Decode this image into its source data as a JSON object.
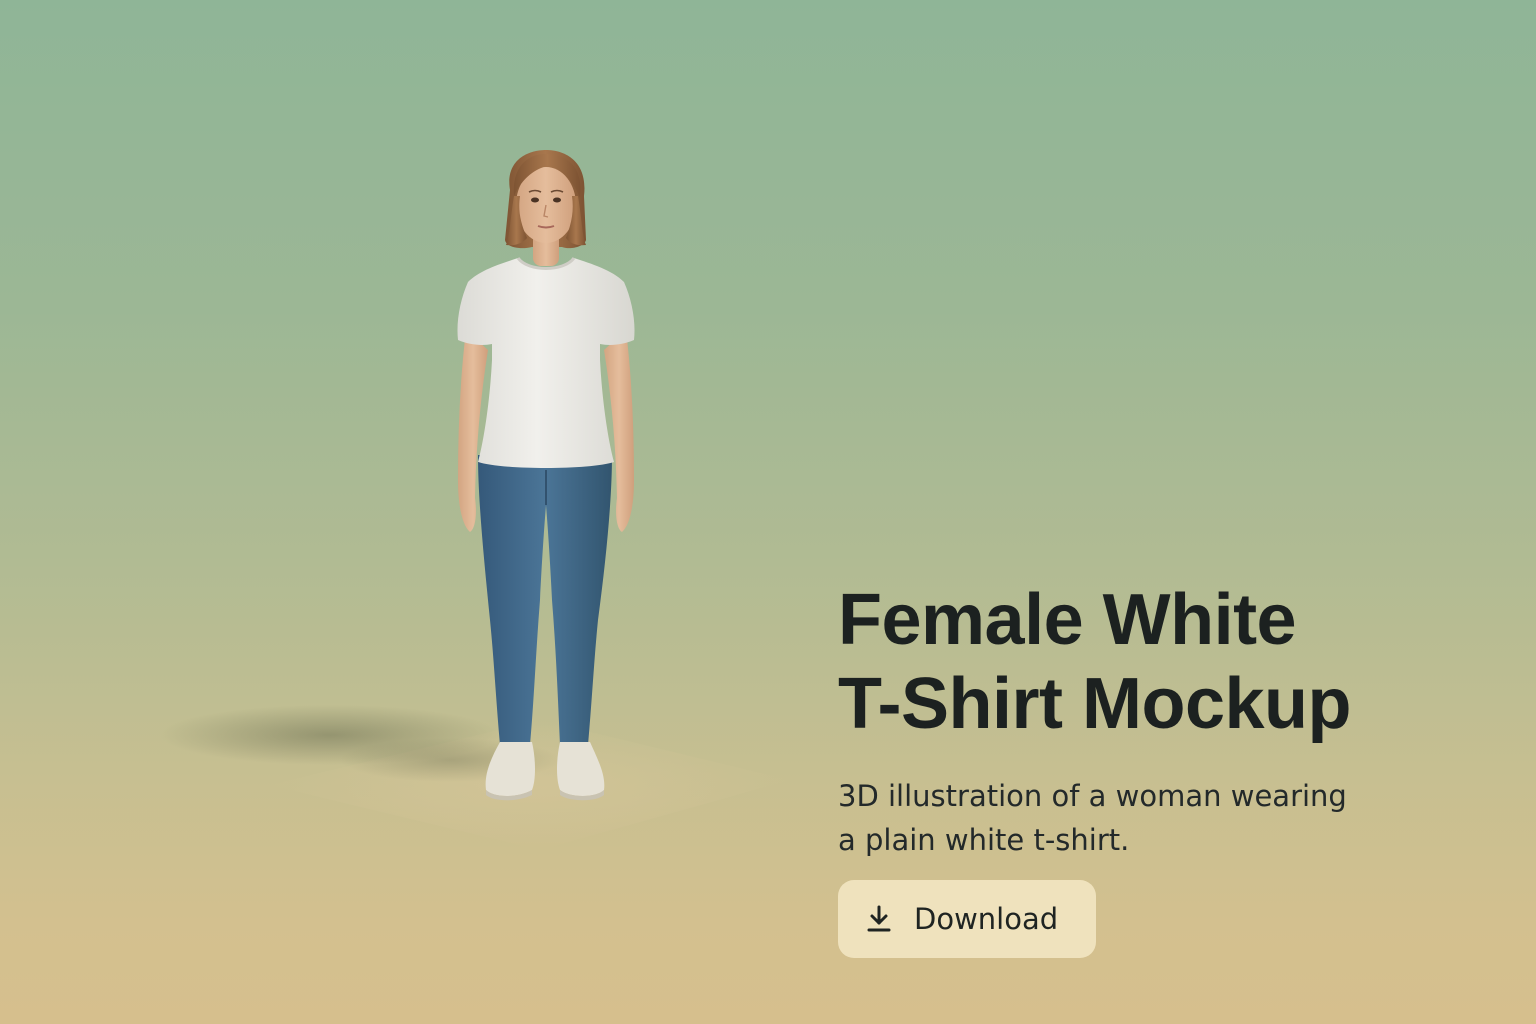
{
  "hero": {
    "title_line1": "Female White",
    "title_line2": "T-Shirt Mockup",
    "description_line1": "3D illustration of a woman wearing",
    "description_line2": "a plain white t-shirt.",
    "download_label": "Download"
  },
  "icons": {
    "download": "download-icon"
  },
  "colors": {
    "background_top": "#8fb597",
    "background_bottom": "#d6bf8d",
    "title_text": "#1c2120",
    "button_bg": "#efe2bd",
    "shirt": "#ecebe8",
    "jeans": "#3f6a8c",
    "hair": "#9a6a43"
  }
}
